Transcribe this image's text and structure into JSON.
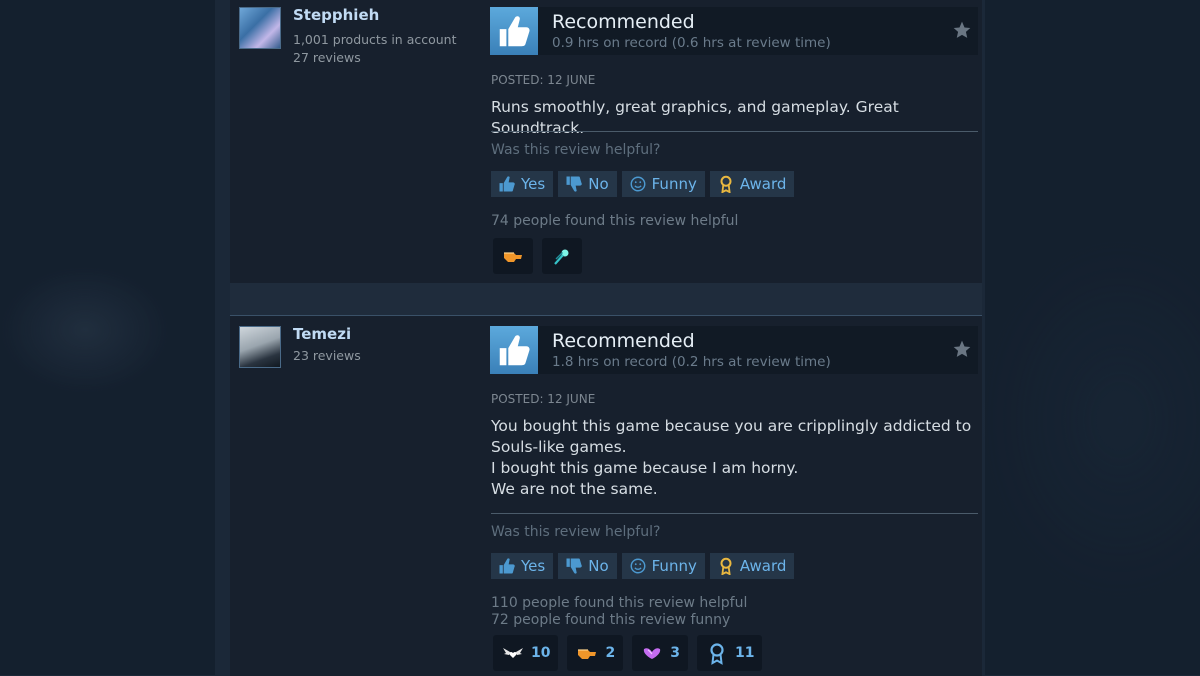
{
  "colors": {
    "page_bg": "#1b2838",
    "card_bg": "#17202d",
    "accent": "#6cb4ea",
    "thumb": "#4c99d0"
  },
  "reviews": [
    {
      "author": {
        "name": "Stepphieh",
        "meta": [
          "1,001 products in account",
          "27 reviews"
        ],
        "avatar_icon": "anime-avatar-icon"
      },
      "verdict": "Recommended",
      "hours": "0.9 hrs on record (0.6 hrs at review time)",
      "posted": "POSTED: 12 JUNE",
      "text": [
        "Runs smoothly, great graphics, and gameplay. Great Soundtrack."
      ],
      "helpful_prompt": "Was this review helpful?",
      "buttons": {
        "yes": "Yes",
        "no": "No",
        "funny": "Funny",
        "award": "Award"
      },
      "stats": [
        "74 people found this review helpful"
      ],
      "awards": [
        {
          "icon": "pointing-hand-icon",
          "count": ""
        },
        {
          "icon": "comet-icon",
          "count": ""
        }
      ]
    },
    {
      "author": {
        "name": "Temezi",
        "meta": [
          "23 reviews"
        ],
        "avatar_icon": "white-hair-avatar-icon"
      },
      "verdict": "Recommended",
      "hours": "1.8 hrs on record (0.2 hrs at review time)",
      "posted": "POSTED: 12 JUNE",
      "text": [
        "You bought this game because you are cripplingly addicted to",
        "Souls-like games.",
        "I bought this game because I am horny.",
        "We are not the same."
      ],
      "helpful_prompt": "Was this review helpful?",
      "buttons": {
        "yes": "Yes",
        "no": "No",
        "funny": "Funny",
        "award": "Award"
      },
      "stats": [
        "110 people found this review helpful",
        "72 people found this review funny"
      ],
      "awards": [
        {
          "icon": "winged-heart-icon",
          "count": "10"
        },
        {
          "icon": "pointing-hand-icon",
          "count": "2"
        },
        {
          "icon": "hug-icon",
          "count": "3"
        },
        {
          "icon": "medal-icon",
          "count": "11"
        }
      ]
    }
  ]
}
